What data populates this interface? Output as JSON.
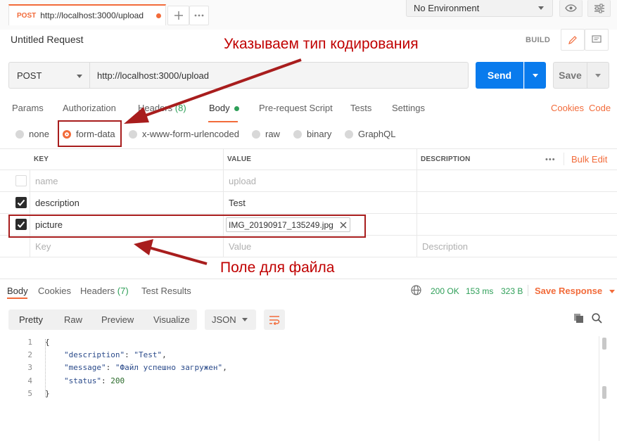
{
  "colors": {
    "accent": "#f26b3a",
    "send": "#097bed",
    "status_ok": "#2e9f58",
    "annotation": "#c00000"
  },
  "tabbar": {
    "tab": {
      "method": "POST",
      "url": "http://localhost:3000/upload"
    },
    "environment": "No Environment"
  },
  "request": {
    "title": "Untitled Request",
    "build_label": "BUILD",
    "method": "POST",
    "url": "http://localhost:3000/upload",
    "send_label": "Send",
    "save_label": "Save"
  },
  "request_tabs": {
    "params": "Params",
    "authorization": "Authorization",
    "headers": "Headers",
    "headers_count": "(8)",
    "body": "Body",
    "prerequest": "Pre-request Script",
    "tests": "Tests",
    "settings": "Settings",
    "cookies": "Cookies",
    "code": "Code"
  },
  "body_types": [
    "none",
    "form-data",
    "x-www-form-urlencoded",
    "raw",
    "binary",
    "GraphQL"
  ],
  "body_type_selected": "form-data",
  "form_table": {
    "headers": {
      "key": "KEY",
      "value": "VALUE",
      "description": "DESCRIPTION"
    },
    "bulk_edit": "Bulk Edit",
    "more": "•••",
    "rows": [
      {
        "key": "name",
        "value": "upload",
        "checked": false
      },
      {
        "key": "description",
        "value": "Test",
        "checked": true
      },
      {
        "key": "picture",
        "value": "IMG_20190917_135249.jpg",
        "checked": true
      }
    ],
    "placeholders": {
      "key": "Key",
      "value": "Value",
      "description": "Description"
    }
  },
  "response": {
    "tabs": {
      "body": "Body",
      "cookies": "Cookies",
      "headers": "Headers",
      "headers_count": "(7)",
      "test_results": "Test Results"
    },
    "status": "200 OK",
    "time": "153 ms",
    "size": "323 B",
    "save_response": "Save Response",
    "view_modes": [
      "Pretty",
      "Raw",
      "Preview",
      "Visualize"
    ],
    "format": "JSON",
    "line_numbers": [
      "1",
      "2",
      "3",
      "4",
      "5"
    ],
    "json": {
      "open": "{",
      "description_key": "\"description\"",
      "description_val": "\"Test\"",
      "message_key": "\"message\"",
      "message_val": "\"Файл успешно загружен\"",
      "status_key": "\"status\"",
      "status_val": "200",
      "close": "}"
    }
  },
  "annotations": {
    "encoding": "Указываем тип кодирования",
    "file_field": "Поле для файла"
  }
}
